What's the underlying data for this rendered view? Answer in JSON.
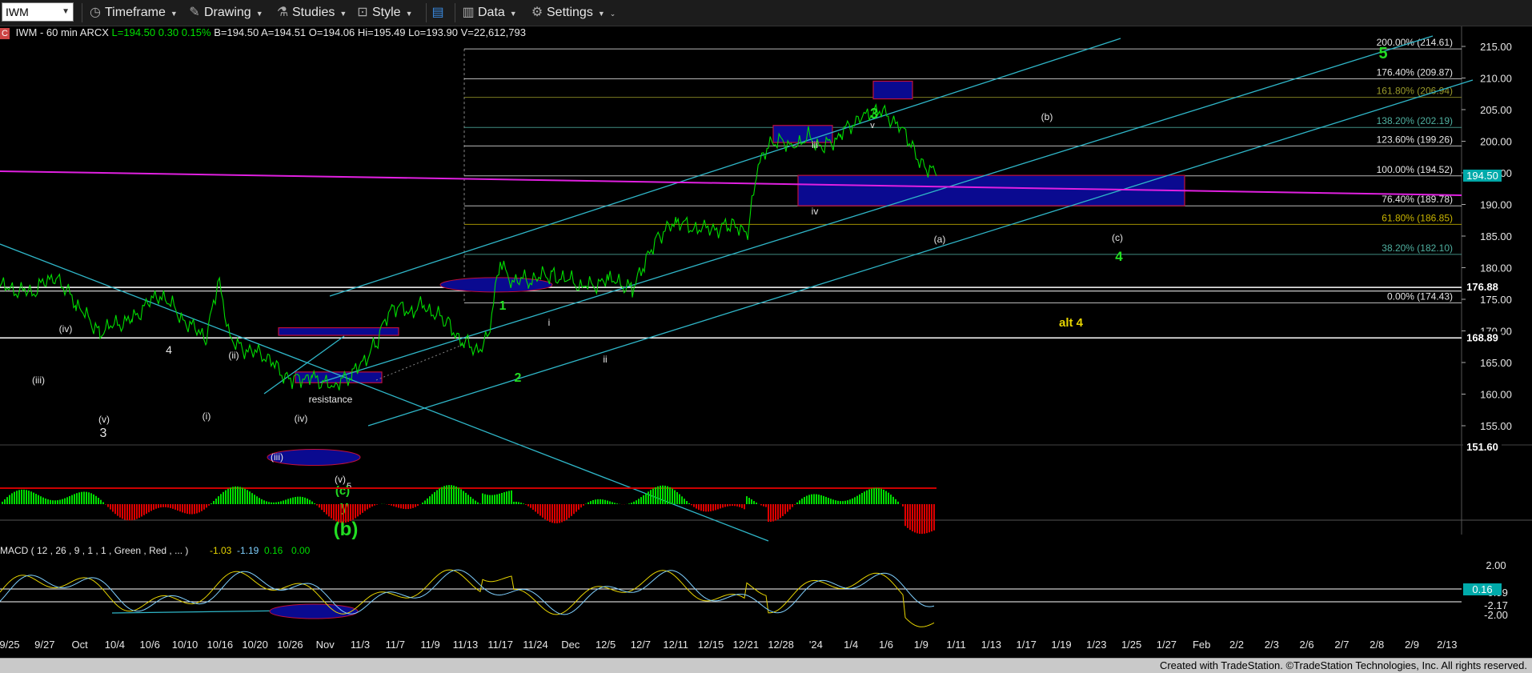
{
  "toolbar": {
    "symbol": "IWM",
    "timeframe": "Timeframe",
    "drawing": "Drawing",
    "studies": "Studies",
    "style": "Style",
    "data": "Data",
    "settings": "Settings"
  },
  "header": {
    "symbol_info": "IWM - 60 min ARCX",
    "last": "L=194.50",
    "change": "0.30",
    "pct": "0.15%",
    "bid": "B=194.50",
    "ask": "A=194.51",
    "open": "O=194.06",
    "high": "Hi=195.49",
    "low": "Lo=193.90",
    "volume": "V=22,612,793"
  },
  "macd_label": "MACD ( 12 , 26 , 9 , 1 , 1 , Green , Red , ... )",
  "macd_values": [
    "-1.03",
    "-1.19",
    "0.16",
    "0.00"
  ],
  "price_axis": [
    "215.00",
    "210.00",
    "205.00",
    "200.00",
    "195.00",
    "190.00",
    "185.00",
    "180.00",
    "175.00",
    "170.00",
    "165.00",
    "160.00",
    "155.00"
  ],
  "price_badges": [
    {
      "label": "194.50",
      "color": "#00c0a0"
    },
    {
      "label": "176.88",
      "color": "#ffffff"
    },
    {
      "label": "168.89",
      "color": "#ffffff"
    },
    {
      "label": "151.60",
      "color": "#ffffff"
    }
  ],
  "macd_axis": [
    "2.00",
    "-0.99",
    "-2.17",
    "-2.00"
  ],
  "macd_badge": "0.16",
  "date_axis": [
    "9/25",
    "9/27",
    "Oct",
    "10/4",
    "10/6",
    "10/10",
    "10/16",
    "10/20",
    "10/26",
    "Nov",
    "11/3",
    "11/7",
    "11/9",
    "11/13",
    "11/17",
    "11/24",
    "Dec",
    "12/5",
    "12/7",
    "12/11",
    "12/15",
    "12/21",
    "12/28",
    "'24",
    "1/4",
    "1/6",
    "1/9",
    "1/11",
    "1/13",
    "1/17",
    "1/19",
    "1/23",
    "1/25",
    "1/27",
    "Feb",
    "2/2",
    "2/3",
    "2/6",
    "2/7",
    "2/8",
    "2/9",
    "2/13"
  ],
  "fib_levels": [
    {
      "label": "200.00% (214.61)",
      "color": "#e6e6e6"
    },
    {
      "label": "176.40% (209.87)",
      "color": "#e6e6e6"
    },
    {
      "label": "161.80% (206.94)",
      "color": "#9a9a2a"
    },
    {
      "label": "138.20% (202.19)",
      "color": "#4fb0a0"
    },
    {
      "label": "123.60% (199.26)",
      "color": "#e6e6e6"
    },
    {
      "label": "100.00% (194.52)",
      "color": "#e6e6e6"
    },
    {
      "label": "76.40% (189.78)",
      "color": "#e6e6e6"
    },
    {
      "label": "61.80% (186.85)",
      "color": "#c8b400"
    },
    {
      "label": "38.20% (182.10)",
      "color": "#4fb0a0"
    },
    {
      "label": "0.00% (174.43)",
      "color": "#e6e6e6"
    }
  ],
  "wave_labels": {
    "w5": "5",
    "w4": "4",
    "alt4": "alt 4",
    "w3": "3",
    "w2": "2",
    "w1": "1",
    "b_big": "(b)",
    "y": "y",
    "c_paren": "(c)",
    "sub5": "5",
    "b_small": "(b)",
    "c_small": "(c)",
    "a_small": "(a)",
    "iii": "iii",
    "iv": "iv",
    "v": "v",
    "i": "i",
    "ii": "ii",
    "p_iv": "(iv)",
    "p_iii": "(iii)",
    "p_v": "(v)",
    "p_ii": "(ii)",
    "p_i": "(i)",
    "n4": "4",
    "n3": "3",
    "p_iv2": "(iv)",
    "p_iii2": "(iii)",
    "p_v2": "(v)",
    "resistance": "resistance"
  },
  "footer": "Created with TradeStation. ©TradeStation Technologies, Inc. All rights reserved.",
  "colors": {
    "price": "#00dd00",
    "channel": "#2fb6c8",
    "magenta": "#e020e0",
    "box": "#0a0a90",
    "box_border": "#c0103a",
    "wave_green": "#22dd22",
    "alt4": "#e6d400"
  },
  "chart_data": {
    "type": "line",
    "title": "",
    "xlabel": "",
    "ylabel": "",
    "ylim": [
      151.6,
      216.5
    ],
    "x": [
      "9/25",
      "10/4",
      "10/16",
      "10/26",
      "11/3",
      "11/13",
      "11/17",
      "12/5",
      "12/15",
      "12/21",
      "12/28",
      "1/4"
    ],
    "series": [
      {
        "values": [
          177,
          170,
          176,
          162,
          175,
          168,
          181,
          186,
          200,
          202,
          205,
          194.5
        ]
      }
    ]
  }
}
